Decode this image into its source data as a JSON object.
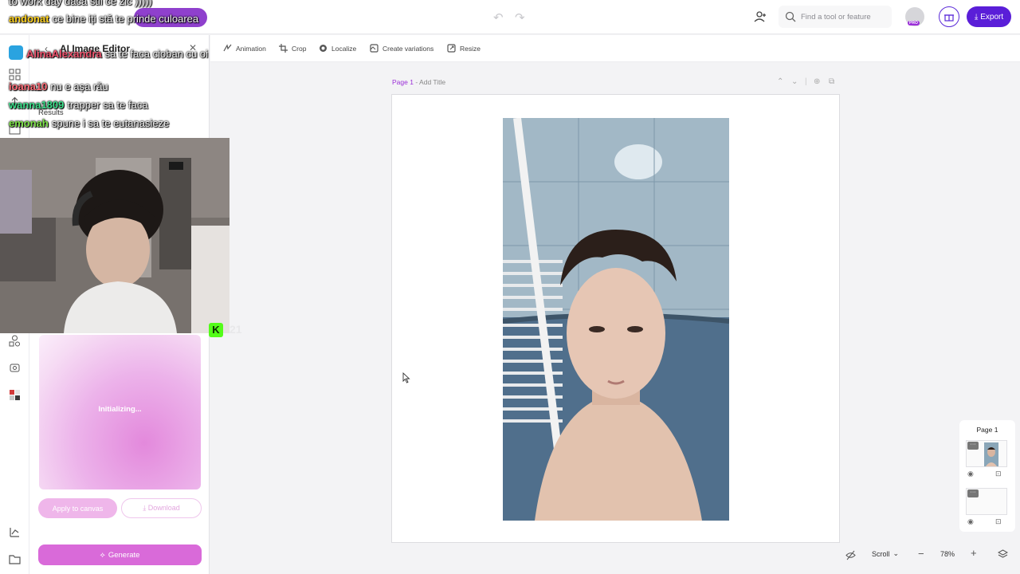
{
  "topbar": {
    "search_placeholder": "Find a tool or feature",
    "pro_badge": "PRO",
    "export_label": "Export"
  },
  "toolbar": {
    "items": [
      {
        "label": "Animation",
        "icon": "animation-icon"
      },
      {
        "label": "Crop",
        "icon": "crop-icon"
      },
      {
        "label": "Localize",
        "icon": "globe-icon"
      },
      {
        "label": "Create variations",
        "icon": "variations-icon"
      },
      {
        "label": "Resize",
        "icon": "resize-icon"
      }
    ]
  },
  "panel": {
    "title": "AI Image Editor",
    "results_label": "Results",
    "status": "Initializing...",
    "apply_label": "Apply to canvas",
    "download_label": "Download",
    "generate_label": "Generate"
  },
  "overlay": {
    "chat": [
      {
        "user": "",
        "text": "to work day daca stii ce zic )))))"
      },
      {
        "user": "andonat",
        "text": "ce bine iți stă te prinde culoarea"
      },
      {
        "user": "AlinaAlexandra",
        "text": "sa te faca cioban cu oi"
      },
      {
        "user": "ioana10",
        "text": "nu e așa rău"
      },
      {
        "user": "wanna1809",
        "text": "trapper sa te faca"
      },
      {
        "user": "emonah",
        "text": "spune i sa te eutanasieze"
      }
    ],
    "viewer_count": "21"
  },
  "canvas": {
    "page_number": "Page 1",
    "page_title": "Add Title"
  },
  "layers_panel": {
    "title": "Page 1"
  },
  "bottombar": {
    "scroll_mode": "Scroll",
    "zoom": "78%"
  },
  "colors": {
    "brand": "#5a1ed8",
    "accent_pink": "#d96ad9",
    "kick_green": "#53fc18"
  }
}
